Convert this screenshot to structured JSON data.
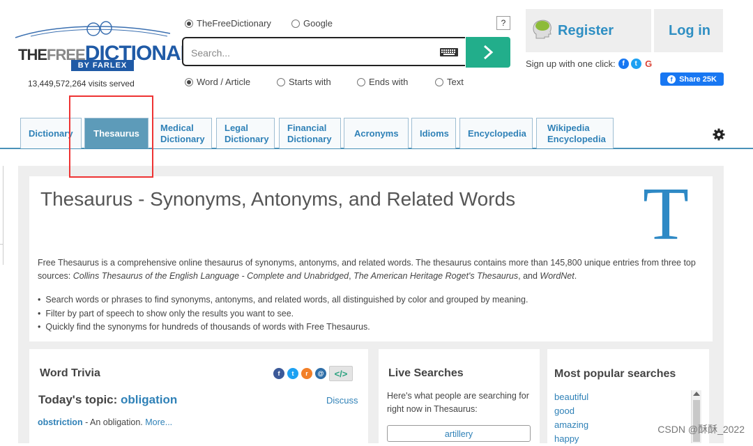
{
  "header": {
    "logo": {
      "line1": "THEFREE",
      "line2": "DICTIONARY",
      "tagline": "BY FARLEX"
    },
    "visits": "13,449,572,264 visits served",
    "sources": [
      {
        "label": "TheFreeDictionary",
        "selected": true
      },
      {
        "label": "Google",
        "selected": false
      }
    ],
    "help_label": "?",
    "search": {
      "placeholder": "Search...",
      "value": ""
    },
    "modes": [
      {
        "label": "Word / Article",
        "selected": true
      },
      {
        "label": "Starts with",
        "selected": false
      },
      {
        "label": "Ends with",
        "selected": false
      },
      {
        "label": "Text",
        "selected": false
      }
    ],
    "register_label": "Register",
    "login_label": "Log in",
    "signup_text": "Sign up with one click:",
    "share_label": "Share 25K"
  },
  "tabs": [
    {
      "label": "Dictionary",
      "active": false
    },
    {
      "label": "Thesaurus",
      "active": true
    },
    {
      "label": "Medical Dictionary",
      "active": false
    },
    {
      "label": "Legal Dictionary",
      "active": false
    },
    {
      "label": "Financial Dictionary",
      "active": false
    },
    {
      "label": "Acronyms",
      "active": false
    },
    {
      "label": "Idioms",
      "active": false
    },
    {
      "label": "Encyclopedia",
      "active": false
    },
    {
      "label": "Wikipedia Encyclopedia",
      "active": false
    }
  ],
  "intro": {
    "title": "Thesaurus - Synonyms, Antonyms, and Related Words",
    "big_letter": "T",
    "p_lead": "Free Thesaurus is a comprehensive online thesaurus of synonyms, antonyms, and related words. The thesaurus contains more than 145,800 unique entries from three top sources: ",
    "p_src1": "Collins Thesaurus of the English Language - Complete and Unabridged",
    "p_sep1": ", ",
    "p_src2": "The American Heritage Roget's Thesaurus",
    "p_sep2": ", and ",
    "p_src3": "WordNet",
    "p_end": ".",
    "bullets": [
      "Search words or phrases to find synonyms, antonyms, and related words, all distinguished by color and grouped by meaning.",
      "Filter by part of speech to show only the results you want to see.",
      "Quickly find the synonyms for hundreds of thousands of words with Free Thesaurus."
    ]
  },
  "trivia": {
    "heading": "Word Trivia",
    "embed_label": "</>",
    "topic_prefix": "Today's topic: ",
    "topic_word": "obligation",
    "discuss_label": "Discuss",
    "def_word": "obstriction",
    "def_text": " - An obligation. ",
    "more_label": "More..."
  },
  "live": {
    "heading": "Live Searches",
    "text": "Here's what people are searching for right now in Thesaurus:",
    "items": [
      "artillery"
    ]
  },
  "popular": {
    "heading": "Most popular searches",
    "items": [
      "beautiful",
      "good",
      "amazing",
      "happy"
    ]
  },
  "watermark": "CSDN @酥酥_2022",
  "colors": {
    "accent": "#2f81b7",
    "go_button": "#22ae8b",
    "active_tab": "#5d9bb9",
    "highlight": "#e33333"
  }
}
